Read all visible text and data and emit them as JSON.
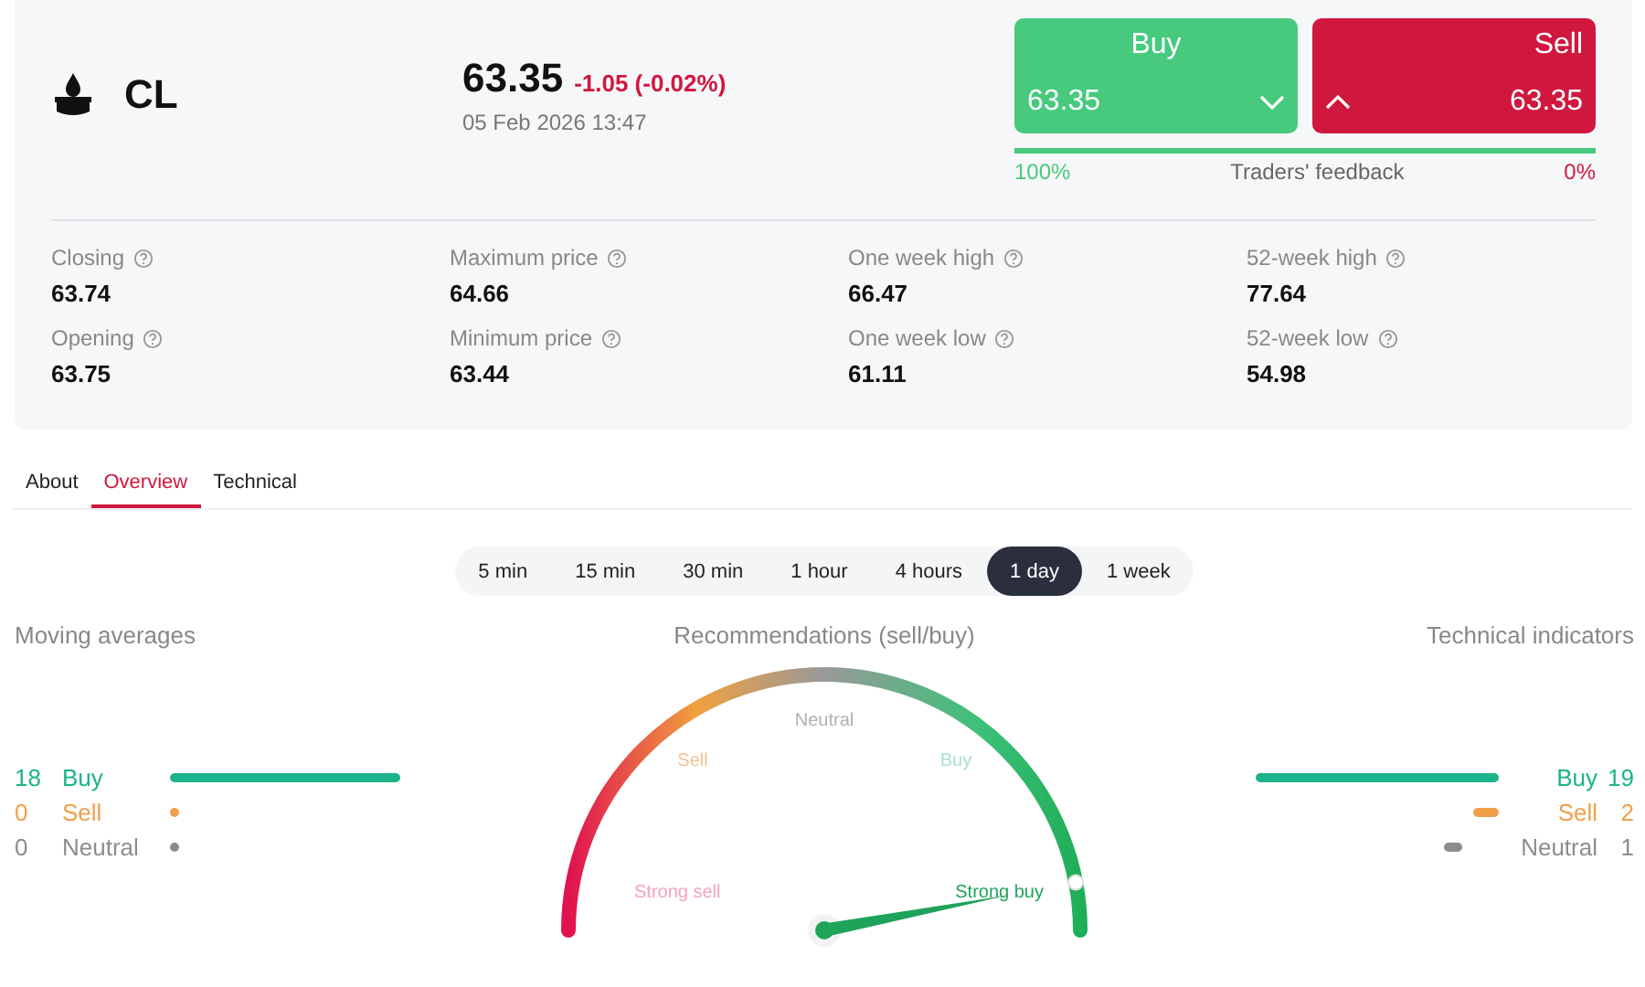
{
  "instrument": {
    "symbol": "CL",
    "price": "63.35",
    "change": "-1.05 (-0.02%)",
    "timestamp": "05 Feb 2026 13:47"
  },
  "trade": {
    "buy": {
      "label": "Buy",
      "price": "63.35"
    },
    "sell": {
      "label": "Sell",
      "price": "63.35"
    },
    "feedback": {
      "buy_share": "100%",
      "label": "Traders' feedback",
      "sell_share": "0%",
      "level": 1
    }
  },
  "stats": [
    {
      "label": "Closing",
      "value": "63.74"
    },
    {
      "label": "Maximum price",
      "value": "64.66"
    },
    {
      "label": "One week high",
      "value": "66.47"
    },
    {
      "label": "52-week high",
      "value": "77.64"
    },
    {
      "label": "Opening",
      "value": "63.75"
    },
    {
      "label": "Minimum price",
      "value": "63.44"
    },
    {
      "label": "One week low",
      "value": "61.11"
    },
    {
      "label": "52-week low",
      "value": "54.98"
    }
  ],
  "tabs": [
    {
      "label": "About",
      "selected": false
    },
    {
      "label": "Overview",
      "selected": true
    },
    {
      "label": "Technical",
      "selected": false
    }
  ],
  "timeframes": [
    {
      "label": "5 min",
      "selected": false
    },
    {
      "label": "15 min",
      "selected": false
    },
    {
      "label": "30 min",
      "selected": false
    },
    {
      "label": "1 hour",
      "selected": false
    },
    {
      "label": "4 hours",
      "selected": false
    },
    {
      "label": "1 day",
      "selected": true
    },
    {
      "label": "1 week",
      "selected": false
    }
  ],
  "moving_averages": {
    "title": "Moving averages",
    "rows": [
      {
        "count": "18",
        "label": "Buy",
        "color": "#1db38a"
      },
      {
        "count": "0",
        "label": "Sell",
        "color": "#f0a04b"
      },
      {
        "count": "0",
        "label": "Neutral",
        "color": "#8c8c8c"
      }
    ]
  },
  "recommendations": {
    "title": "Recommendations (sell/buy)",
    "labels": [
      "Strong sell",
      "Sell",
      "Neutral",
      "Buy",
      "Strong buy"
    ],
    "level": 0.94
  },
  "technical_indicators": {
    "title": "Technical indicators",
    "rows": [
      {
        "count": "19",
        "label": "Buy",
        "color": "#1db38a"
      },
      {
        "count": "2",
        "label": "Sell",
        "color": "#f0a04b"
      },
      {
        "count": "1",
        "label": "Neutral",
        "color": "#8c8c8c"
      }
    ]
  }
}
